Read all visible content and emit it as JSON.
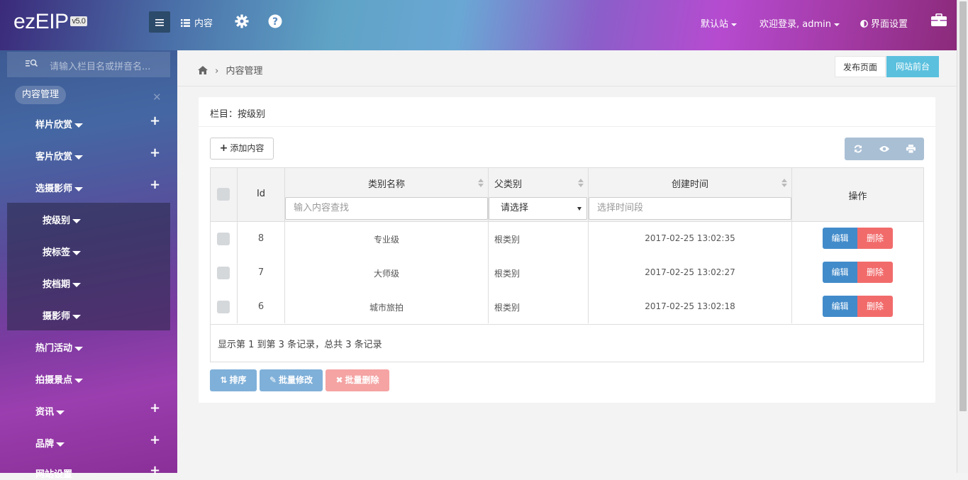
{
  "header": {
    "logo": "ezEIP",
    "version": "v5.0",
    "nav_content": "内容",
    "default_site": "默认站",
    "welcome": "欢迎登录, admin",
    "ui_settings": "界面设置"
  },
  "sidebar": {
    "search_placeholder": "请输入栏目名或拼音名...",
    "section_title": "内容管理",
    "items": [
      {
        "label": "样片欣赏",
        "has_plus": true
      },
      {
        "label": "客片欣赏",
        "has_plus": true
      },
      {
        "label": "选摄影师",
        "has_plus": true
      },
      {
        "label": "热门活动",
        "has_plus": false
      },
      {
        "label": "拍摄景点",
        "has_plus": false
      },
      {
        "label": "资讯",
        "has_plus": true
      },
      {
        "label": "品牌",
        "has_plus": true
      },
      {
        "label": "网站设置",
        "has_plus": true
      }
    ],
    "sub_items": [
      {
        "label": "按级别"
      },
      {
        "label": "按标签"
      },
      {
        "label": "按档期"
      },
      {
        "label": "摄影师"
      }
    ]
  },
  "breadcrumb": {
    "current": "内容管理"
  },
  "top_actions": {
    "publish": "发布页面",
    "frontend": "网站前台"
  },
  "panel": {
    "title": "栏目：按级别",
    "add_button": "添加内容"
  },
  "table": {
    "columns": {
      "id": "Id",
      "name": "类别名称",
      "parent": "父类别",
      "created": "创建时间",
      "actions": "操作"
    },
    "filters": {
      "name_placeholder": "输入内容查找",
      "parent_selected": "请选择",
      "time_placeholder": "选择时间段"
    },
    "rows": [
      {
        "id": "8",
        "name": "专业级",
        "parent": "根类别",
        "created": "2017-02-25 13:02:35"
      },
      {
        "id": "7",
        "name": "大师级",
        "parent": "根类别",
        "created": "2017-02-25 13:02:27"
      },
      {
        "id": "6",
        "name": "城市旅拍",
        "parent": "根类别",
        "created": "2017-02-25 13:02:18"
      }
    ],
    "edit_label": "编辑",
    "delete_label": "删除",
    "footer": "显示第 1 到第 3 条记录，总共 3 条记录"
  },
  "bulk": {
    "sort": "排序",
    "edit": "批量修改",
    "delete": "批量删除"
  }
}
